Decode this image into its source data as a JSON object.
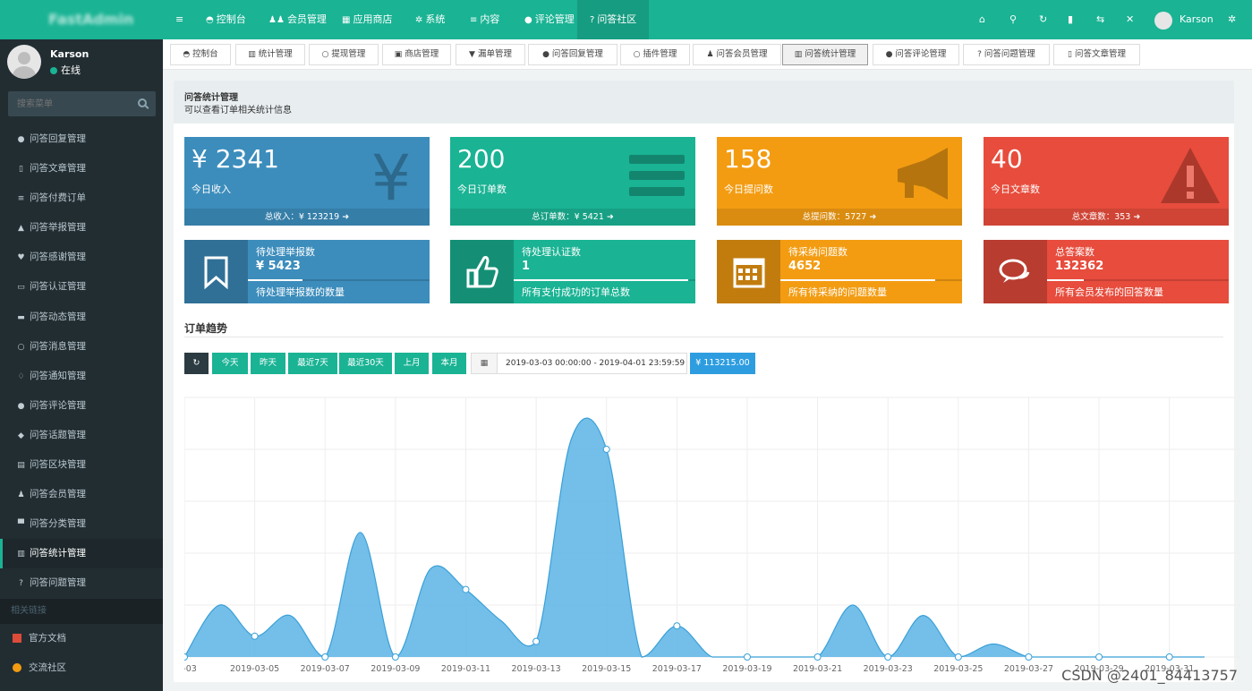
{
  "brand": {
    "primary": "#1ab394",
    "sidebar_bg": "#222d32"
  },
  "user": {
    "name": "Karson",
    "status": "在线"
  },
  "search": {
    "placeholder": "搜索菜单"
  },
  "sidebar": {
    "items": [
      {
        "label": "问答回复管理",
        "icon": "comment-icon"
      },
      {
        "label": "问答文章管理",
        "icon": "file-icon"
      },
      {
        "label": "问答付费订单",
        "icon": "list-icon"
      },
      {
        "label": "问答举报管理",
        "icon": "warning-icon"
      },
      {
        "label": "问答感谢管理",
        "icon": "heart-icon"
      },
      {
        "label": "问答认证管理",
        "icon": "id-card-icon"
      },
      {
        "label": "问答动态管理",
        "icon": "coffee-icon"
      },
      {
        "label": "问答消息管理",
        "icon": "comment-o-icon"
      },
      {
        "label": "问答通知管理",
        "icon": "bell-icon"
      },
      {
        "label": "问答评论管理",
        "icon": "comments-icon"
      },
      {
        "label": "问答话题管理",
        "icon": "tag-icon"
      },
      {
        "label": "问答区块管理",
        "icon": "file-text-icon"
      },
      {
        "label": "问答会员管理",
        "icon": "user-icon"
      },
      {
        "label": "问答分类管理",
        "icon": "folder-icon"
      },
      {
        "label": "问答统计管理",
        "icon": "bar-chart-icon",
        "active": true
      },
      {
        "label": "问答问题管理",
        "icon": "question-icon"
      }
    ],
    "links_header": "相关链接",
    "links": [
      {
        "label": "官方文档",
        "color": "#dd4b39"
      },
      {
        "label": "交流社区",
        "color": "#f39c12"
      }
    ]
  },
  "navbar": {
    "items": [
      {
        "label": "控制台",
        "icon": "dashboard-icon"
      },
      {
        "label": "会员管理",
        "icon": "users-icon"
      },
      {
        "label": "应用商店",
        "icon": "th-icon"
      },
      {
        "label": "系统",
        "icon": "cogs-icon"
      },
      {
        "label": "内容",
        "icon": "list-icon"
      },
      {
        "label": "评论管理",
        "icon": "comments-icon"
      },
      {
        "label": "问答社区",
        "icon": "question-icon",
        "active": true
      }
    ],
    "right_icons": [
      "home-icon",
      "search-icon",
      "refresh-icon",
      "trash-icon",
      "language-icon",
      "fullscreen-icon"
    ],
    "user_name": "Karson",
    "settings_icon": "cogs-icon"
  },
  "tabs": [
    {
      "label": "控制台",
      "icon": "dashboard-icon"
    },
    {
      "label": "统计管理",
      "icon": "bar-chart-icon"
    },
    {
      "label": "提现管理",
      "icon": "circle-o-icon"
    },
    {
      "label": "商店管理",
      "icon": "gift-icon"
    },
    {
      "label": "漏单管理",
      "icon": "filter-icon"
    },
    {
      "label": "问答回复管理",
      "icon": "comment-icon"
    },
    {
      "label": "插件管理",
      "icon": "circle-o-icon"
    },
    {
      "label": "问答会员管理",
      "icon": "user-icon"
    },
    {
      "label": "问答统计管理",
      "icon": "bar-chart-icon",
      "active": true
    },
    {
      "label": "问答评论管理",
      "icon": "comments-icon"
    },
    {
      "label": "问答问题管理",
      "icon": "question-icon"
    },
    {
      "label": "问答文章管理",
      "icon": "file-icon"
    }
  ],
  "page": {
    "title": "问答统计管理",
    "description": "可以查看订单相关统计信息"
  },
  "stats": [
    {
      "value": "¥ 2341",
      "label": "今日收入",
      "footer": "总收入：¥ 123219",
      "color": "#3c8dbc",
      "icon": "yen-icon"
    },
    {
      "value": "200",
      "label": "今日订单数",
      "footer": "总订单数：¥ 5421",
      "color": "#1ab394",
      "icon": "list-icon"
    },
    {
      "value": "158",
      "label": "今日提问数",
      "footer": "总提问数：5727",
      "color": "#f39c12",
      "icon": "bullhorn-icon"
    },
    {
      "value": "40",
      "label": "今日文章数",
      "footer": "总文章数：353",
      "color": "#e74c3c",
      "icon": "warning-icon"
    }
  ],
  "info_boxes": [
    {
      "title": "待处理举报数",
      "value": "¥ 5423",
      "desc": "待处理举报数的数量",
      "color": "#3c8dbc",
      "icon": "bookmark-icon",
      "progress": 0.3
    },
    {
      "title": "待处理认证数",
      "value": "1",
      "desc": "所有支付成功的订单总数",
      "color": "#1ab394",
      "icon": "thumbs-up-icon",
      "progress": 0.96
    },
    {
      "title": "待采纳问题数",
      "value": "4652",
      "desc": "所有待采纳的问题数量",
      "color": "#f39c12",
      "icon": "calendar-icon",
      "progress": 0.85
    },
    {
      "title": "总答案数",
      "value": "132362",
      "desc": "所有会员发布的回答数量",
      "color": "#e74c3c",
      "icon": "comments-icon",
      "progress": 0.2
    }
  ],
  "trend": {
    "title": "订单趋势",
    "buttons": [
      "今天",
      "昨天",
      "最近7天",
      "最近30天",
      "上月",
      "本月"
    ],
    "refresh_icon": "refresh-icon",
    "calendar_icon": "calendar-icon",
    "date_range": "2019-03-03 00:00:00 - 2019-04-01 23:59:59",
    "total": "¥ 113215.00"
  },
  "chart_data": {
    "type": "area",
    "x": [
      "2019-03-03",
      "2019-03-04",
      "2019-03-05",
      "2019-03-06",
      "2019-03-07",
      "2019-03-08",
      "2019-03-09",
      "2019-03-10",
      "2019-03-11",
      "2019-03-12",
      "2019-03-13",
      "2019-03-14",
      "2019-03-15",
      "2019-03-16",
      "2019-03-17",
      "2019-03-18",
      "2019-03-19",
      "2019-03-20",
      "2019-03-21",
      "2019-03-22",
      "2019-03-23",
      "2019-03-24",
      "2019-03-25",
      "2019-03-26",
      "2019-03-27",
      "2019-03-28",
      "2019-03-29",
      "2019-03-30",
      "2019-03-31",
      "2019-04-01"
    ],
    "tick_labels": [
      "03-03",
      "2019-03-05",
      "2019-03-07",
      "2019-03-09",
      "2019-03-11",
      "2019-03-13",
      "2019-03-15",
      "2019-03-17",
      "2019-03-19",
      "2019-03-21",
      "2019-03-23",
      "2019-03-25",
      "2019-03-27",
      "2019-03-29",
      "2019-03-31"
    ],
    "values": [
      0,
      1000,
      400,
      800,
      0,
      2400,
      0,
      1700,
      1300,
      700,
      300,
      4200,
      4000,
      0,
      600,
      0,
      0,
      0,
      0,
      1000,
      0,
      800,
      0,
      250,
      0,
      0,
      0,
      0,
      0,
      0
    ],
    "ylim": [
      0,
      5000
    ],
    "grid": true,
    "color": "#5ab4e5"
  },
  "watermark": "CSDN @2401_84413757"
}
